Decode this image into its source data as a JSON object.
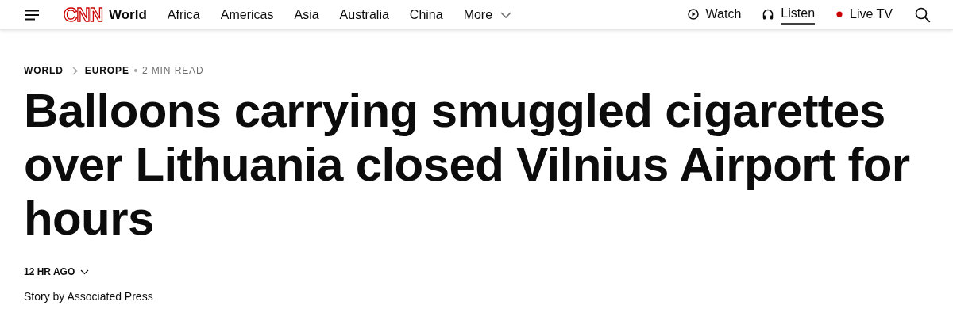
{
  "header": {
    "logo": "CNN",
    "section": "World",
    "nav": [
      {
        "label": "Africa"
      },
      {
        "label": "Americas"
      },
      {
        "label": "Asia"
      },
      {
        "label": "Australia"
      },
      {
        "label": "China"
      },
      {
        "label": "More",
        "kind": "dropdown"
      }
    ],
    "actions": [
      {
        "label": "Watch",
        "kind": "watch",
        "selected": false
      },
      {
        "label": "Listen",
        "kind": "listen",
        "selected": true
      },
      {
        "label": "Live TV",
        "kind": "live",
        "selected": false
      }
    ]
  },
  "breadcrumb": {
    "items": [
      "WORLD",
      "EUROPE"
    ],
    "read_time": "2 MIN READ"
  },
  "headline": "Balloons carrying smuggled cigarettes over Lithuania closed Vilnius Airport for hours",
  "timestamp": "12 HR AGO",
  "byline": "Story by Associated Press"
}
